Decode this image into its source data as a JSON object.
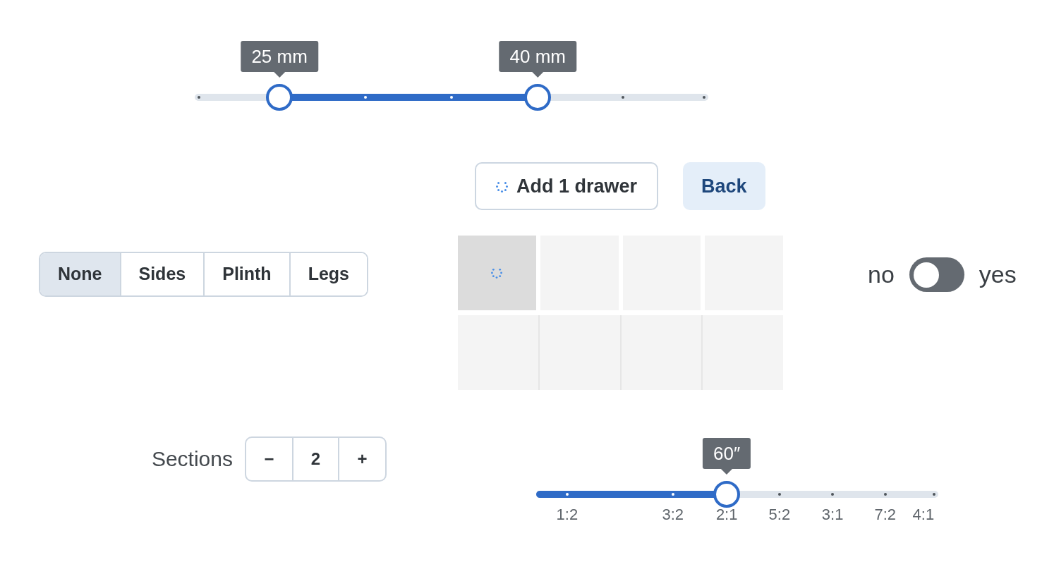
{
  "thickness_slider": {
    "handles": [
      {
        "tooltip": "25 mm",
        "level": 0.165
      },
      {
        "tooltip": "40 mm",
        "level": 0.668
      }
    ]
  },
  "action_buttons": [
    {
      "label": "Add 1 drawer",
      "kind": "outline",
      "loading": true
    },
    {
      "label": "Back",
      "kind": "soft",
      "loading": false
    }
  ],
  "base_options": [
    {
      "label": "None",
      "selected": true
    },
    {
      "label": "Sides",
      "selected": false
    },
    {
      "label": "Plinth",
      "selected": false
    },
    {
      "label": "Legs",
      "selected": false
    }
  ],
  "drawer_grid": {
    "rows": [
      {
        "kind": "spaced",
        "cells": [
          {
            "loading": true
          },
          {
            "loading": false
          },
          {
            "loading": false
          },
          {
            "loading": false
          }
        ]
      },
      {
        "kind": "joined",
        "cells": [
          {
            "loading": false
          },
          {
            "loading": false
          },
          {
            "loading": false
          },
          {
            "loading": false
          }
        ]
      }
    ]
  },
  "toggle": {
    "off_label": "no",
    "on": false,
    "on_label": "yes"
  },
  "sections_stepper": {
    "label": "Sections",
    "decrement": "−",
    "value": "2",
    "increment": "+"
  },
  "ratio_slider": {
    "tooltip": "60″",
    "level": 0.474,
    "tick_labels": [
      "1:2",
      "3:2",
      "2:1",
      "5:2",
      "3:1",
      "7:2",
      "4:1"
    ]
  }
}
